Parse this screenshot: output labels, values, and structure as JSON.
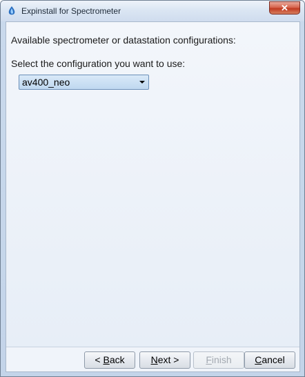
{
  "window": {
    "title": "Expinstall for Spectrometer",
    "close_symbol": "✕"
  },
  "content": {
    "heading": "Available spectrometer or datastation configurations:",
    "select_label": "Select the configuration you want to use:",
    "configuration": {
      "selected": "av400_neo"
    }
  },
  "buttons": {
    "back": {
      "prefix": "< ",
      "mnemonic": "B",
      "rest": "ack"
    },
    "next": {
      "mnemonic": "N",
      "rest": "ext >"
    },
    "finish": {
      "mnemonic": "F",
      "rest": "inish"
    },
    "cancel": {
      "mnemonic": "C",
      "rest": "ancel"
    }
  },
  "colors": {
    "accent": "#6b8fb8",
    "close_button": "#c13b22",
    "disabled_text": "#a3a9b1"
  },
  "icons": {
    "app": "spectrometer-app-icon",
    "close": "close-icon",
    "dropdown": "chevron-down-icon"
  }
}
